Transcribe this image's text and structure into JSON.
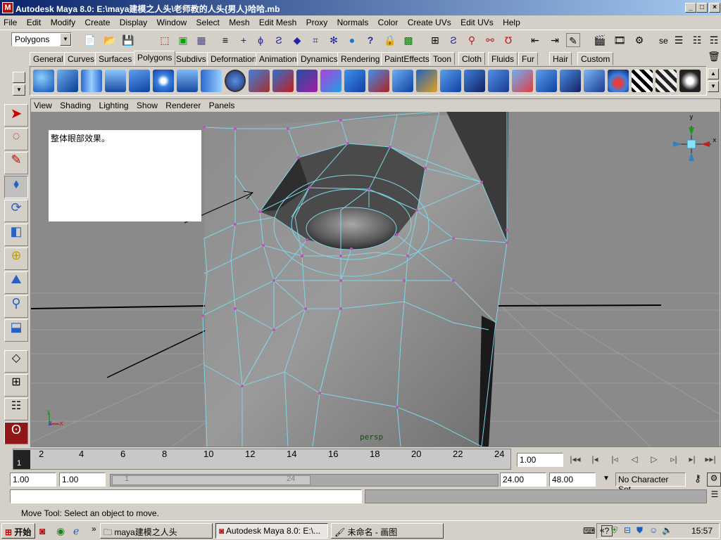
{
  "window": {
    "title": "Autodesk Maya 8.0: E:\\maya建模之人头\\老师教的人头{男人}哈哈.mb",
    "icon": "maya-app-icon"
  },
  "menubar": [
    "File",
    "Edit",
    "Modify",
    "Create",
    "Display",
    "Window",
    "Select",
    "Mesh",
    "Edit Mesh",
    "Proxy",
    "Normals",
    "Color",
    "Create UVs",
    "Edit UVs",
    "Help"
  ],
  "statusline": {
    "menuset": "Polygons",
    "select_field": "se"
  },
  "shelf_tabs": [
    "General",
    "Curves",
    "Surfaces",
    "Polygons",
    "Subdivs",
    "Deformation",
    "Animation",
    "Dynamics",
    "Rendering",
    "PaintEffects",
    "Toon",
    "Cloth",
    "Fluids",
    "Fur",
    "Hair",
    "Custom"
  ],
  "active_shelf_tab": "Polygons",
  "panel_menu": [
    "View",
    "Shading",
    "Lighting",
    "Show",
    "Renderer",
    "Panels"
  ],
  "viewport": {
    "note_text": "整体眼部效果。",
    "camera_label": "persp",
    "view_cube_axis_y": "y",
    "view_cube_axis_x": "x",
    "axis_y": "y",
    "axis_z": "z",
    "axis_x": "x"
  },
  "timeslider": {
    "ticks": [
      "2",
      "4",
      "6",
      "8",
      "10",
      "12",
      "14",
      "16",
      "18",
      "20",
      "22",
      "24"
    ],
    "current_frame": "1",
    "current_time_field": "1.00"
  },
  "rangeslider": {
    "start_time": "1.00",
    "playback_start": "1.00",
    "range_start_label": "1",
    "range_end_label": "24",
    "playback_end": "24.00",
    "end_time": "48.00",
    "character_set": "No Character Set"
  },
  "helpline": "Move Tool: Select an object to move.",
  "taskbar": {
    "start": "开始",
    "buttons": [
      "maya建模之人头",
      "Autodesk Maya 8.0: E:\\...",
      "未命名 - 画图"
    ],
    "clock": "15:57"
  },
  "colors": {
    "title_active": "#0a246a",
    "wire": "#7fd7e8",
    "vertex": "#c050c0",
    "viewport_bg": "#8a8a8a"
  }
}
